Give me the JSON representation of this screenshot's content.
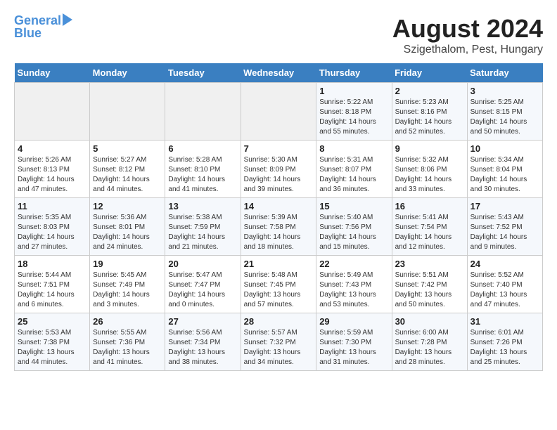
{
  "header": {
    "logo_line1": "General",
    "logo_line2": "Blue",
    "month_year": "August 2024",
    "location": "Szigethalom, Pest, Hungary"
  },
  "weekdays": [
    "Sunday",
    "Monday",
    "Tuesday",
    "Wednesday",
    "Thursday",
    "Friday",
    "Saturday"
  ],
  "weeks": [
    [
      {
        "day": "",
        "info": ""
      },
      {
        "day": "",
        "info": ""
      },
      {
        "day": "",
        "info": ""
      },
      {
        "day": "",
        "info": ""
      },
      {
        "day": "1",
        "info": "Sunrise: 5:22 AM\nSunset: 8:18 PM\nDaylight: 14 hours\nand 55 minutes."
      },
      {
        "day": "2",
        "info": "Sunrise: 5:23 AM\nSunset: 8:16 PM\nDaylight: 14 hours\nand 52 minutes."
      },
      {
        "day": "3",
        "info": "Sunrise: 5:25 AM\nSunset: 8:15 PM\nDaylight: 14 hours\nand 50 minutes."
      }
    ],
    [
      {
        "day": "4",
        "info": "Sunrise: 5:26 AM\nSunset: 8:13 PM\nDaylight: 14 hours\nand 47 minutes."
      },
      {
        "day": "5",
        "info": "Sunrise: 5:27 AM\nSunset: 8:12 PM\nDaylight: 14 hours\nand 44 minutes."
      },
      {
        "day": "6",
        "info": "Sunrise: 5:28 AM\nSunset: 8:10 PM\nDaylight: 14 hours\nand 41 minutes."
      },
      {
        "day": "7",
        "info": "Sunrise: 5:30 AM\nSunset: 8:09 PM\nDaylight: 14 hours\nand 39 minutes."
      },
      {
        "day": "8",
        "info": "Sunrise: 5:31 AM\nSunset: 8:07 PM\nDaylight: 14 hours\nand 36 minutes."
      },
      {
        "day": "9",
        "info": "Sunrise: 5:32 AM\nSunset: 8:06 PM\nDaylight: 14 hours\nand 33 minutes."
      },
      {
        "day": "10",
        "info": "Sunrise: 5:34 AM\nSunset: 8:04 PM\nDaylight: 14 hours\nand 30 minutes."
      }
    ],
    [
      {
        "day": "11",
        "info": "Sunrise: 5:35 AM\nSunset: 8:03 PM\nDaylight: 14 hours\nand 27 minutes."
      },
      {
        "day": "12",
        "info": "Sunrise: 5:36 AM\nSunset: 8:01 PM\nDaylight: 14 hours\nand 24 minutes."
      },
      {
        "day": "13",
        "info": "Sunrise: 5:38 AM\nSunset: 7:59 PM\nDaylight: 14 hours\nand 21 minutes."
      },
      {
        "day": "14",
        "info": "Sunrise: 5:39 AM\nSunset: 7:58 PM\nDaylight: 14 hours\nand 18 minutes."
      },
      {
        "day": "15",
        "info": "Sunrise: 5:40 AM\nSunset: 7:56 PM\nDaylight: 14 hours\nand 15 minutes."
      },
      {
        "day": "16",
        "info": "Sunrise: 5:41 AM\nSunset: 7:54 PM\nDaylight: 14 hours\nand 12 minutes."
      },
      {
        "day": "17",
        "info": "Sunrise: 5:43 AM\nSunset: 7:52 PM\nDaylight: 14 hours\nand 9 minutes."
      }
    ],
    [
      {
        "day": "18",
        "info": "Sunrise: 5:44 AM\nSunset: 7:51 PM\nDaylight: 14 hours\nand 6 minutes."
      },
      {
        "day": "19",
        "info": "Sunrise: 5:45 AM\nSunset: 7:49 PM\nDaylight: 14 hours\nand 3 minutes."
      },
      {
        "day": "20",
        "info": "Sunrise: 5:47 AM\nSunset: 7:47 PM\nDaylight: 14 hours\nand 0 minutes."
      },
      {
        "day": "21",
        "info": "Sunrise: 5:48 AM\nSunset: 7:45 PM\nDaylight: 13 hours\nand 57 minutes."
      },
      {
        "day": "22",
        "info": "Sunrise: 5:49 AM\nSunset: 7:43 PM\nDaylight: 13 hours\nand 53 minutes."
      },
      {
        "day": "23",
        "info": "Sunrise: 5:51 AM\nSunset: 7:42 PM\nDaylight: 13 hours\nand 50 minutes."
      },
      {
        "day": "24",
        "info": "Sunrise: 5:52 AM\nSunset: 7:40 PM\nDaylight: 13 hours\nand 47 minutes."
      }
    ],
    [
      {
        "day": "25",
        "info": "Sunrise: 5:53 AM\nSunset: 7:38 PM\nDaylight: 13 hours\nand 44 minutes."
      },
      {
        "day": "26",
        "info": "Sunrise: 5:55 AM\nSunset: 7:36 PM\nDaylight: 13 hours\nand 41 minutes."
      },
      {
        "day": "27",
        "info": "Sunrise: 5:56 AM\nSunset: 7:34 PM\nDaylight: 13 hours\nand 38 minutes."
      },
      {
        "day": "28",
        "info": "Sunrise: 5:57 AM\nSunset: 7:32 PM\nDaylight: 13 hours\nand 34 minutes."
      },
      {
        "day": "29",
        "info": "Sunrise: 5:59 AM\nSunset: 7:30 PM\nDaylight: 13 hours\nand 31 minutes."
      },
      {
        "day": "30",
        "info": "Sunrise: 6:00 AM\nSunset: 7:28 PM\nDaylight: 13 hours\nand 28 minutes."
      },
      {
        "day": "31",
        "info": "Sunrise: 6:01 AM\nSunset: 7:26 PM\nDaylight: 13 hours\nand 25 minutes."
      }
    ]
  ]
}
